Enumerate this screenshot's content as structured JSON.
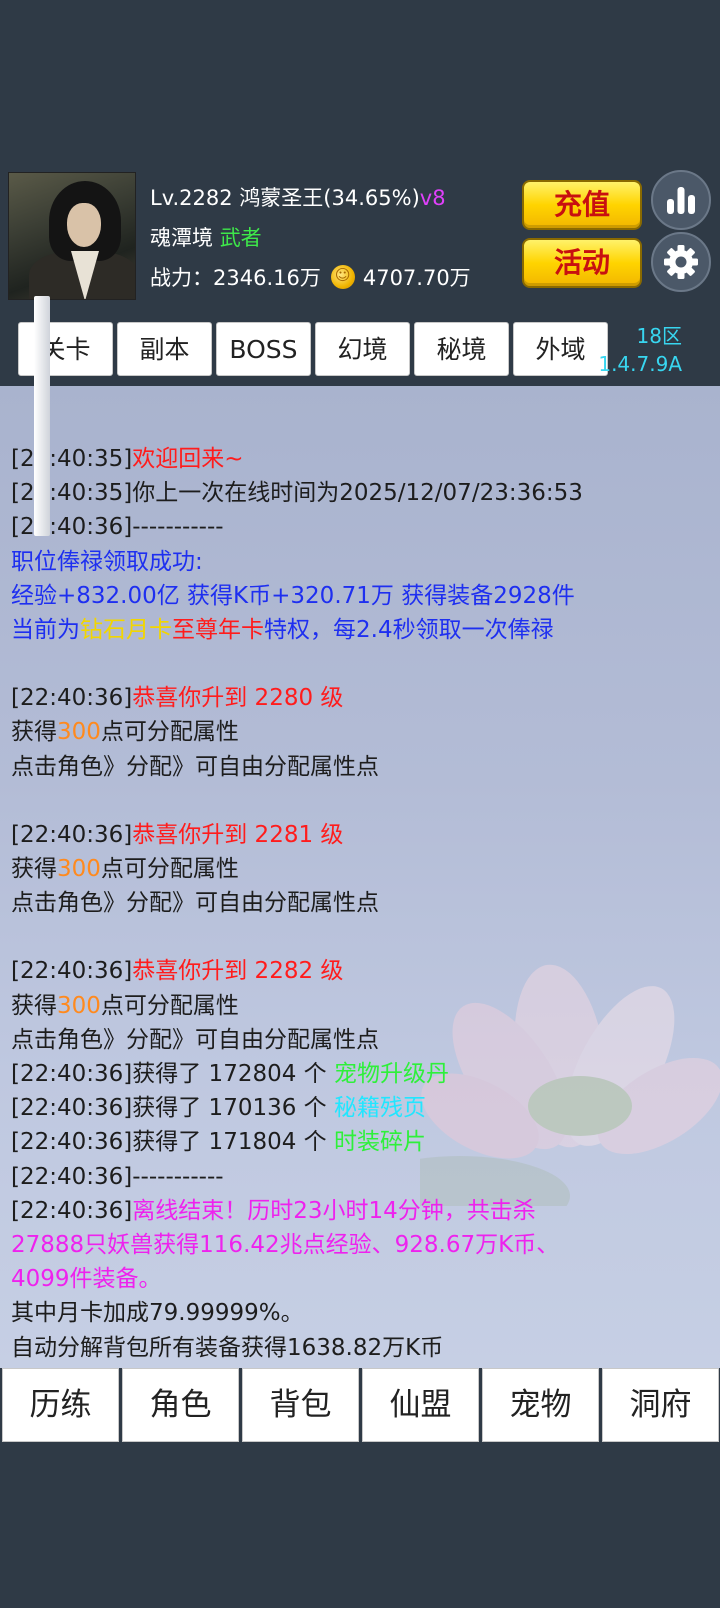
{
  "player": {
    "level": "Lv.2282",
    "title": "鸿蒙圣王(34.65%)",
    "vip": "v8",
    "realm": "魂潭境",
    "rank": "武者",
    "power_label": "战力：",
    "power_value": "2346.16万",
    "gold": "4707.70万"
  },
  "buttons": {
    "recharge": "充值",
    "activity": "活动"
  },
  "tabs": [
    "关卡",
    "副本",
    "BOSS",
    "幻境",
    "秘境",
    "外域"
  ],
  "server": {
    "zone": "18区",
    "version": "1.4.7.9A"
  },
  "log": {
    "l1_time": "[22:40:35]",
    "l1_text": "欢迎回来~",
    "l2_time": "[22:40:35]",
    "l2_text": "你上一次在线时间为2025/12/07/23:36:53",
    "l3": "[22:40:36]-----------",
    "salary_title": "职位俸禄领取成功:",
    "salary_detail": "经验+832.00亿 获得K币+320.71万 获得装备2928件",
    "privilege_a": "当前为",
    "privilege_b": "钻石月卡",
    "privilege_c": "至尊年卡",
    "privilege_d": "特权，每2.4秒领取一次俸禄",
    "levelups": [
      {
        "time": "[22:40:36]",
        "msg": "恭喜你升到 2280 级"
      },
      {
        "time": "[22:40:36]",
        "msg": "恭喜你升到 2281 级"
      },
      {
        "time": "[22:40:36]",
        "msg": "恭喜你升到 2282 级"
      }
    ],
    "attr_a": "获得",
    "attr_points": "300",
    "attr_b": "点可分配属性",
    "attr_hint": "点击角色》分配》可自由分配属性点",
    "items": [
      {
        "time": "[22:40:36]",
        "text": "获得了 172804 个 ",
        "item": "宠物升级丹"
      },
      {
        "time": "[22:40:36]",
        "text": "获得了 170136 个 ",
        "item": "秘籍残页"
      },
      {
        "time": "[22:40:36]",
        "text": "获得了 171804 个 ",
        "item": "时装碎片"
      }
    ],
    "sep2": "[22:40:36]-----------",
    "offline_time": "[22:40:36]",
    "offline_1": "离线结束！历时23小时14分钟，共击杀",
    "offline_2": "27888只妖兽获得116.42兆点经验、928.67万K币、",
    "offline_3": "4099件装备。",
    "bonus": "其中月卡加成79.99999%。",
    "decompose": "自动分解背包所有装备获得1638.82万K币"
  },
  "bottom_nav": [
    "历练",
    "角色",
    "背包",
    "仙盟",
    "宠物",
    "洞府"
  ]
}
